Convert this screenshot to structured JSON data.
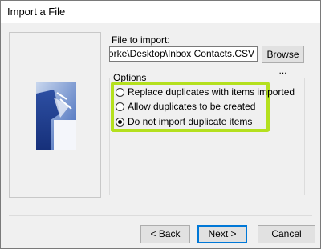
{
  "window": {
    "title": "Import a File"
  },
  "file": {
    "label": "File to import:",
    "path": "C:\\Users\\siobhanororke\\Desktop\\Inbox Contacts.CSV",
    "browse_label": "Browse ..."
  },
  "options": {
    "legend": "Options",
    "items": [
      {
        "label": "Replace duplicates with items imported",
        "checked": false
      },
      {
        "label": "Allow duplicates to be created",
        "checked": false
      },
      {
        "label": "Do not import duplicate items",
        "checked": true
      }
    ]
  },
  "buttons": {
    "back": "< Back",
    "next": "Next >",
    "cancel": "Cancel"
  },
  "colors": {
    "highlight": "#b4e01e",
    "primary_border": "#0078d7"
  }
}
